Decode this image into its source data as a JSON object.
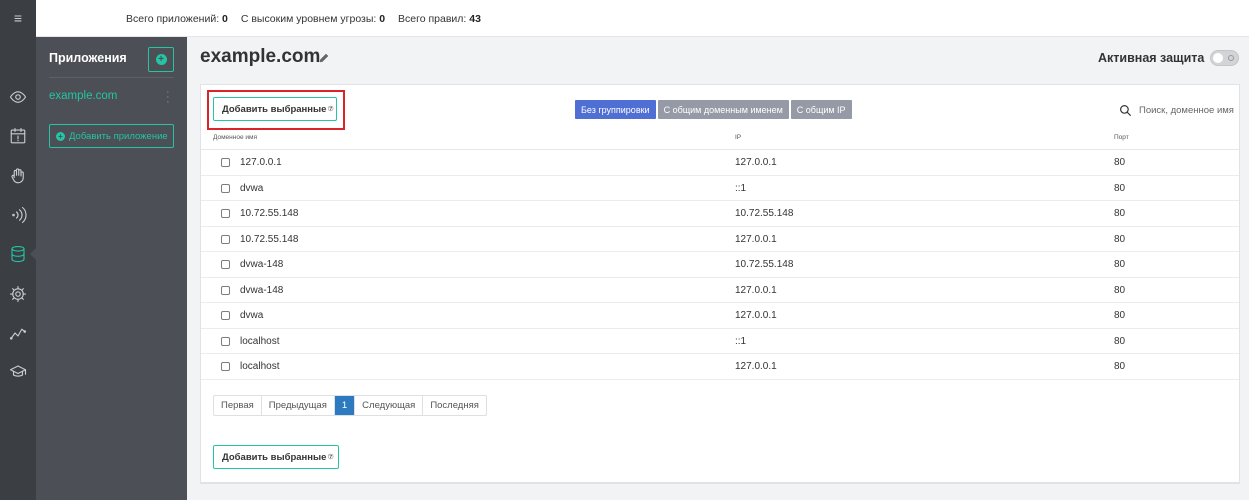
{
  "topbar": {
    "stats": [
      {
        "label": "Всего приложений:",
        "value": "0"
      },
      {
        "label": "С высоким уровнем угрозы:",
        "value": "0"
      },
      {
        "label": "Всего правил:",
        "value": "43"
      }
    ]
  },
  "rail": {
    "menu_icon": "≡",
    "icons": [
      "eye-icon",
      "calendar-alert-icon",
      "hand-icon",
      "broadcast-icon",
      "database-icon",
      "gear-icon",
      "activity-icon",
      "graduation-cap-icon"
    ],
    "active": "database-icon"
  },
  "apps_sidebar": {
    "title": "Приложения",
    "add_icon": "plus-circle-icon",
    "items": [
      {
        "label": "example.com"
      }
    ],
    "add_app_label": "Добавить приложение"
  },
  "header": {
    "title": "example.com",
    "edit_icon": "pencil-icon",
    "protection_label": "Активная защита",
    "protection_on": false
  },
  "toolbar": {
    "add_selected_label": "Добавить выбранные",
    "help_mark": "⑦",
    "group_buttons": [
      {
        "label": "Без группировки",
        "active": true
      },
      {
        "label": "С общим доменным именем",
        "active": false
      },
      {
        "label": "С общим IP",
        "active": false
      }
    ],
    "search_placeholder": "Поиск, доменное имя"
  },
  "table": {
    "columns": [
      "Доменное имя",
      "IP",
      "Порт"
    ],
    "rows": [
      {
        "domain": "127.0.0.1",
        "ip": "127.0.0.1",
        "port": "80"
      },
      {
        "domain": "dvwa",
        "ip": "::1",
        "port": "80"
      },
      {
        "domain": "10.72.55.148",
        "ip": "10.72.55.148",
        "port": "80"
      },
      {
        "domain": "10.72.55.148",
        "ip": "127.0.0.1",
        "port": "80"
      },
      {
        "domain": "dvwa-148",
        "ip": "10.72.55.148",
        "port": "80"
      },
      {
        "domain": "dvwa-148",
        "ip": "127.0.0.1",
        "port": "80"
      },
      {
        "domain": "dvwa",
        "ip": "127.0.0.1",
        "port": "80"
      },
      {
        "domain": "localhost",
        "ip": "::1",
        "port": "80"
      },
      {
        "domain": "localhost",
        "ip": "127.0.0.1",
        "port": "80"
      }
    ]
  },
  "pagination": {
    "first": "Первая",
    "prev": "Предыдущая",
    "current": "1",
    "next": "Следующая",
    "last": "Последняя"
  },
  "colors": {
    "accent": "#23c5a4",
    "highlight": "#d9252a",
    "group_active": "#4f6fd4",
    "page_active": "#2d7ac0"
  }
}
